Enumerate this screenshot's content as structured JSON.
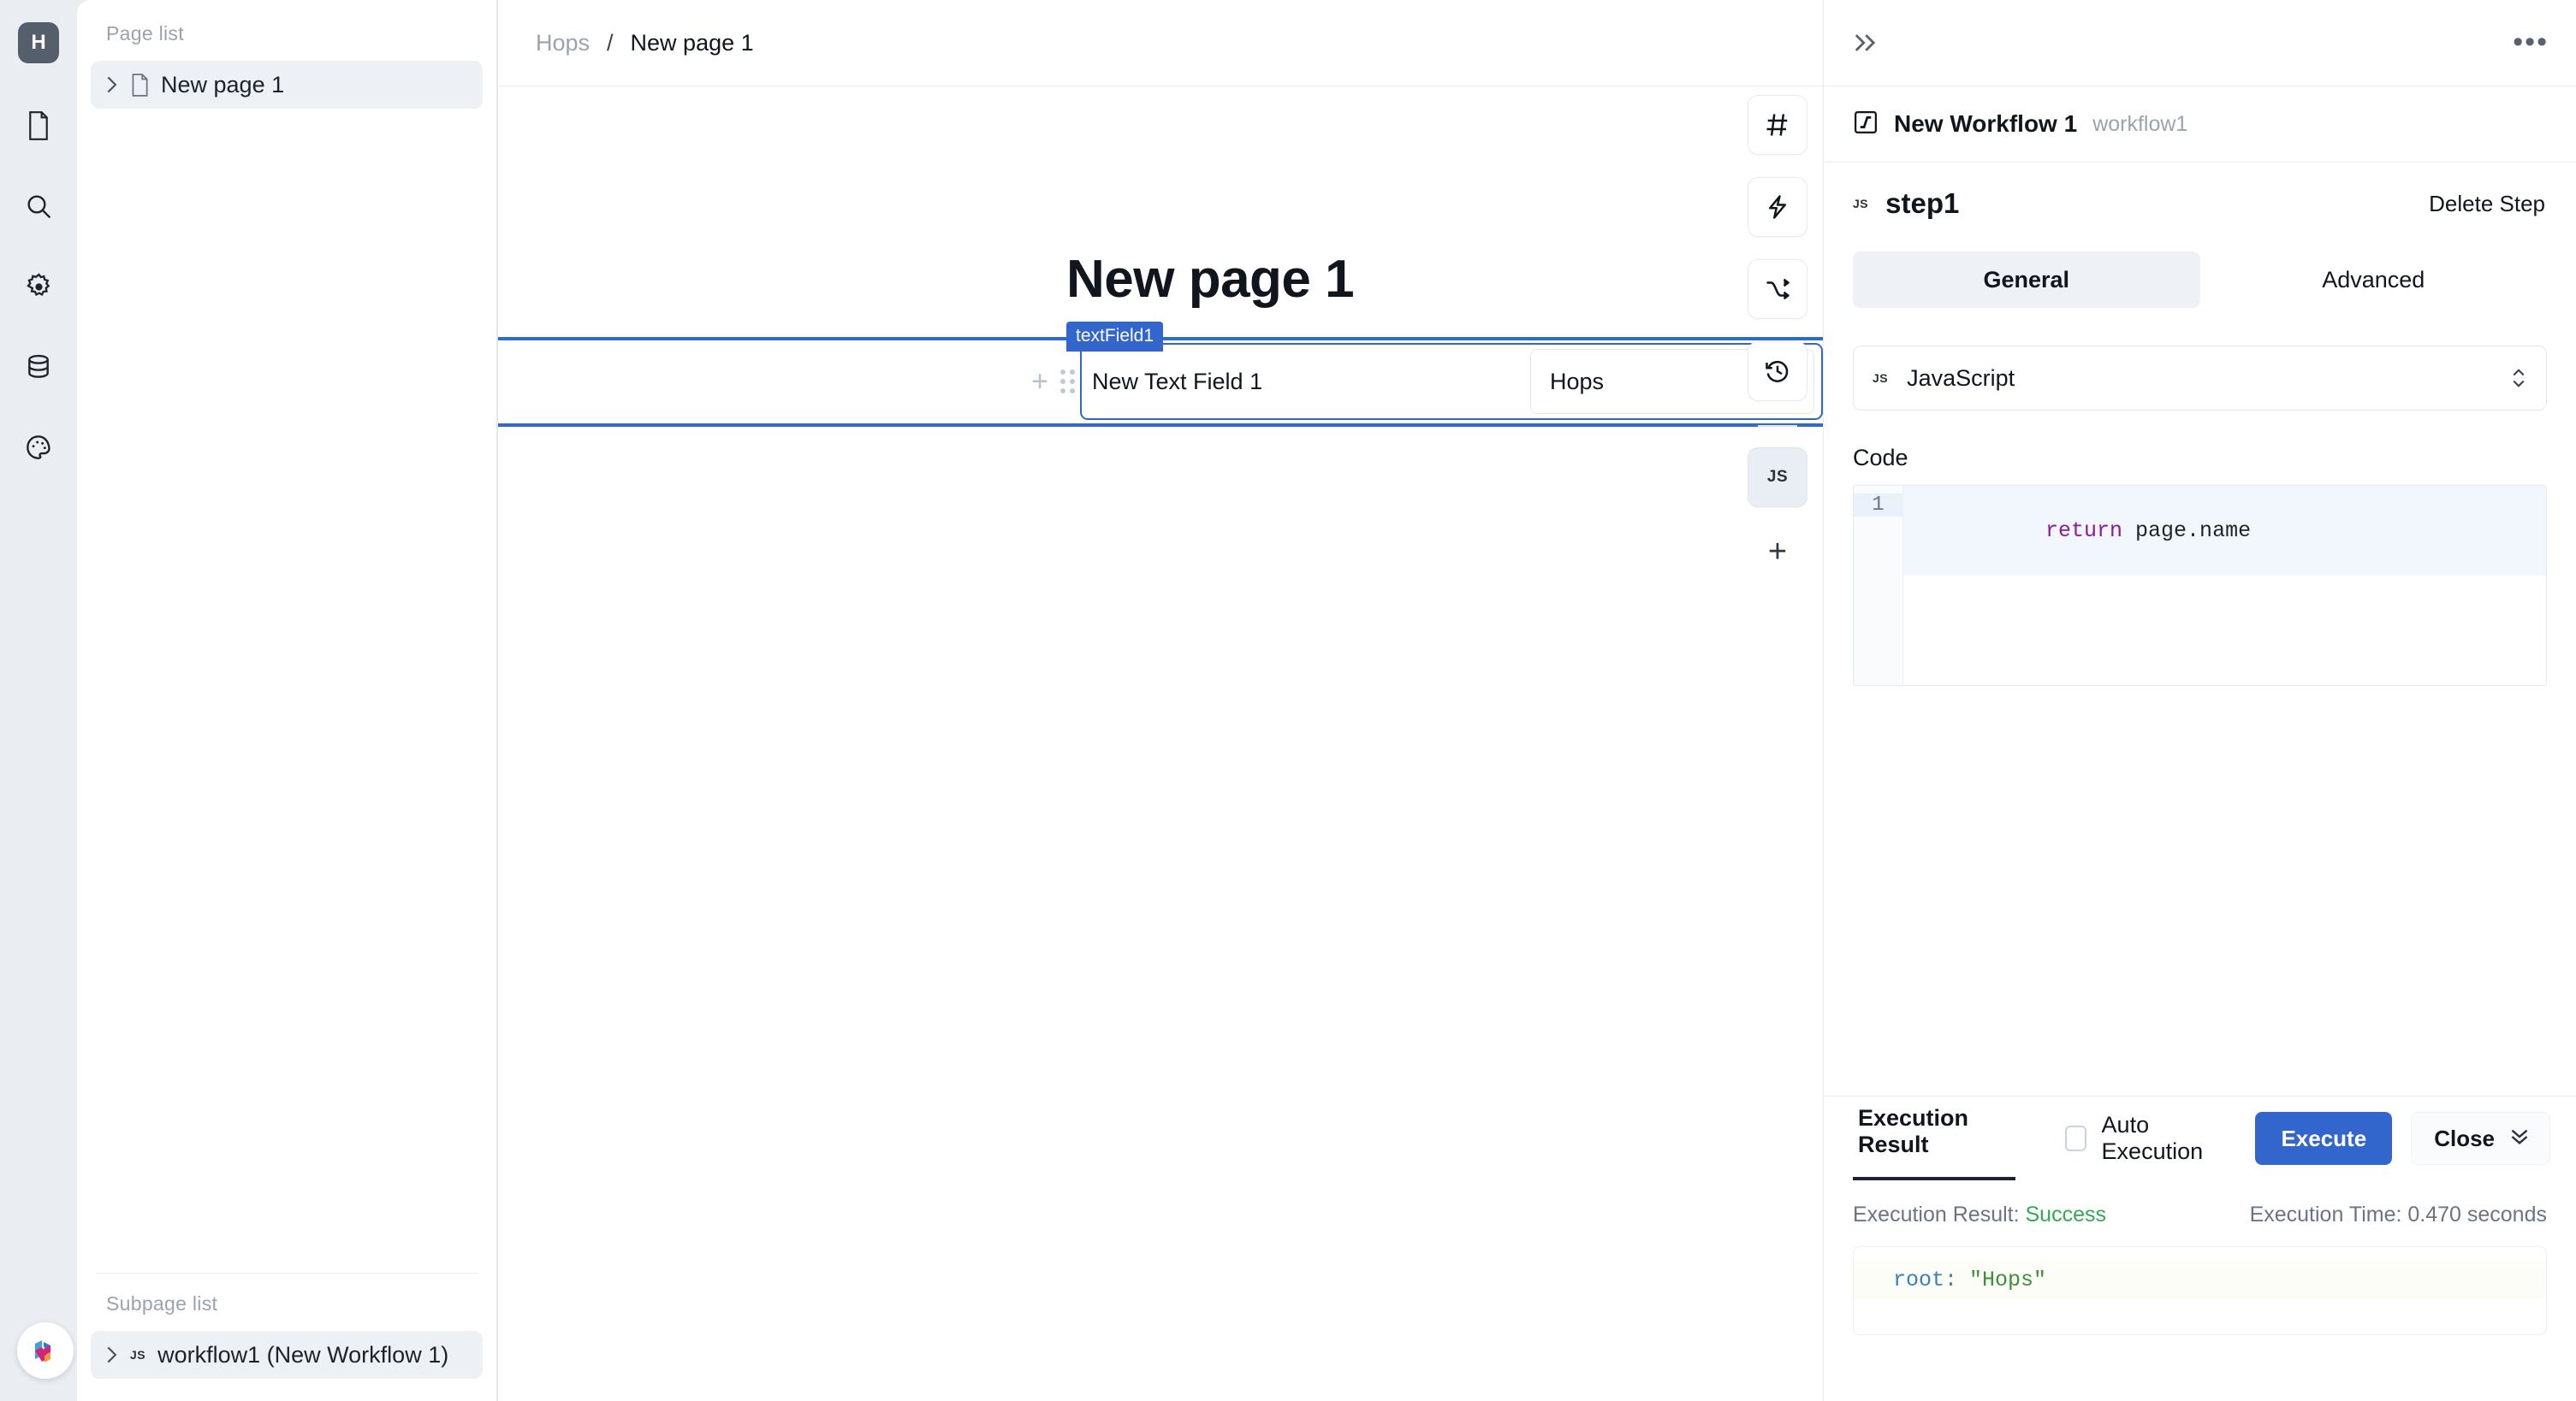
{
  "rail": {
    "logo_label": "H",
    "items": [
      {
        "name": "document-icon",
        "label": "Document"
      },
      {
        "name": "search-icon",
        "label": "Search"
      },
      {
        "name": "gear-icon",
        "label": "Settings"
      },
      {
        "name": "database-icon",
        "label": "Database"
      },
      {
        "name": "palette-icon",
        "label": "Theme"
      }
    ]
  },
  "sidebar": {
    "page_list_label": "Page list",
    "pages": [
      {
        "label": "New page 1",
        "selected": true
      }
    ],
    "subpage_list_label": "Subpage list",
    "subpages": [
      {
        "label": "workflow1 (New Workflow 1)",
        "badge": "JS",
        "selected": true
      }
    ]
  },
  "breadcrumb": {
    "root": "Hops",
    "separator": "/",
    "leaf": "New page 1"
  },
  "canvas": {
    "page_title": "New page 1",
    "component_tag": "textField1",
    "field_label": "New Text Field 1",
    "field_value": "Hops",
    "add_row_glyph": "+"
  },
  "tools": [
    {
      "name": "hash-icon",
      "label": "#",
      "active": false
    },
    {
      "name": "lightning-icon",
      "label": "Event",
      "active": false
    },
    {
      "name": "branch-icon",
      "label": "Flow",
      "active": false
    },
    {
      "name": "history-icon",
      "label": "History",
      "active": false
    },
    {
      "name": "js-icon",
      "label": "JS",
      "active": true
    }
  ],
  "tool_add_glyph": "+",
  "right_panel": {
    "collapse_glyph": "»",
    "more_glyph": "•••",
    "workflow_title": "New Workflow 1",
    "workflow_id": "workflow1",
    "step_badge": "JS",
    "step_name": "step1",
    "delete_step_label": "Delete Step",
    "tabs": [
      {
        "label": "General",
        "active": true
      },
      {
        "label": "Advanced",
        "active": false
      }
    ],
    "language_badge": "JS",
    "language": "JavaScript",
    "code_label": "Code",
    "code_line_number": "1",
    "code_keyword": "return",
    "code_rest": " page.name"
  },
  "execution": {
    "tab_label": "Execution Result",
    "auto_execution_label": "Auto Execution",
    "auto_execution_checked": false,
    "execute_label": "Execute",
    "close_label": "Close",
    "result_prefix": "Execution Result:",
    "result_status": "Success",
    "time_text": "Execution Time: 0.470 seconds",
    "output_key": "root:",
    "output_value": "\"Hops\""
  },
  "colors": {
    "accent_blue": "#3366cc",
    "selection_blue": "#2f6ac9",
    "success_green": "#35a853",
    "rail_bg": "#eaeef3",
    "logo_bg": "#555e6b"
  }
}
